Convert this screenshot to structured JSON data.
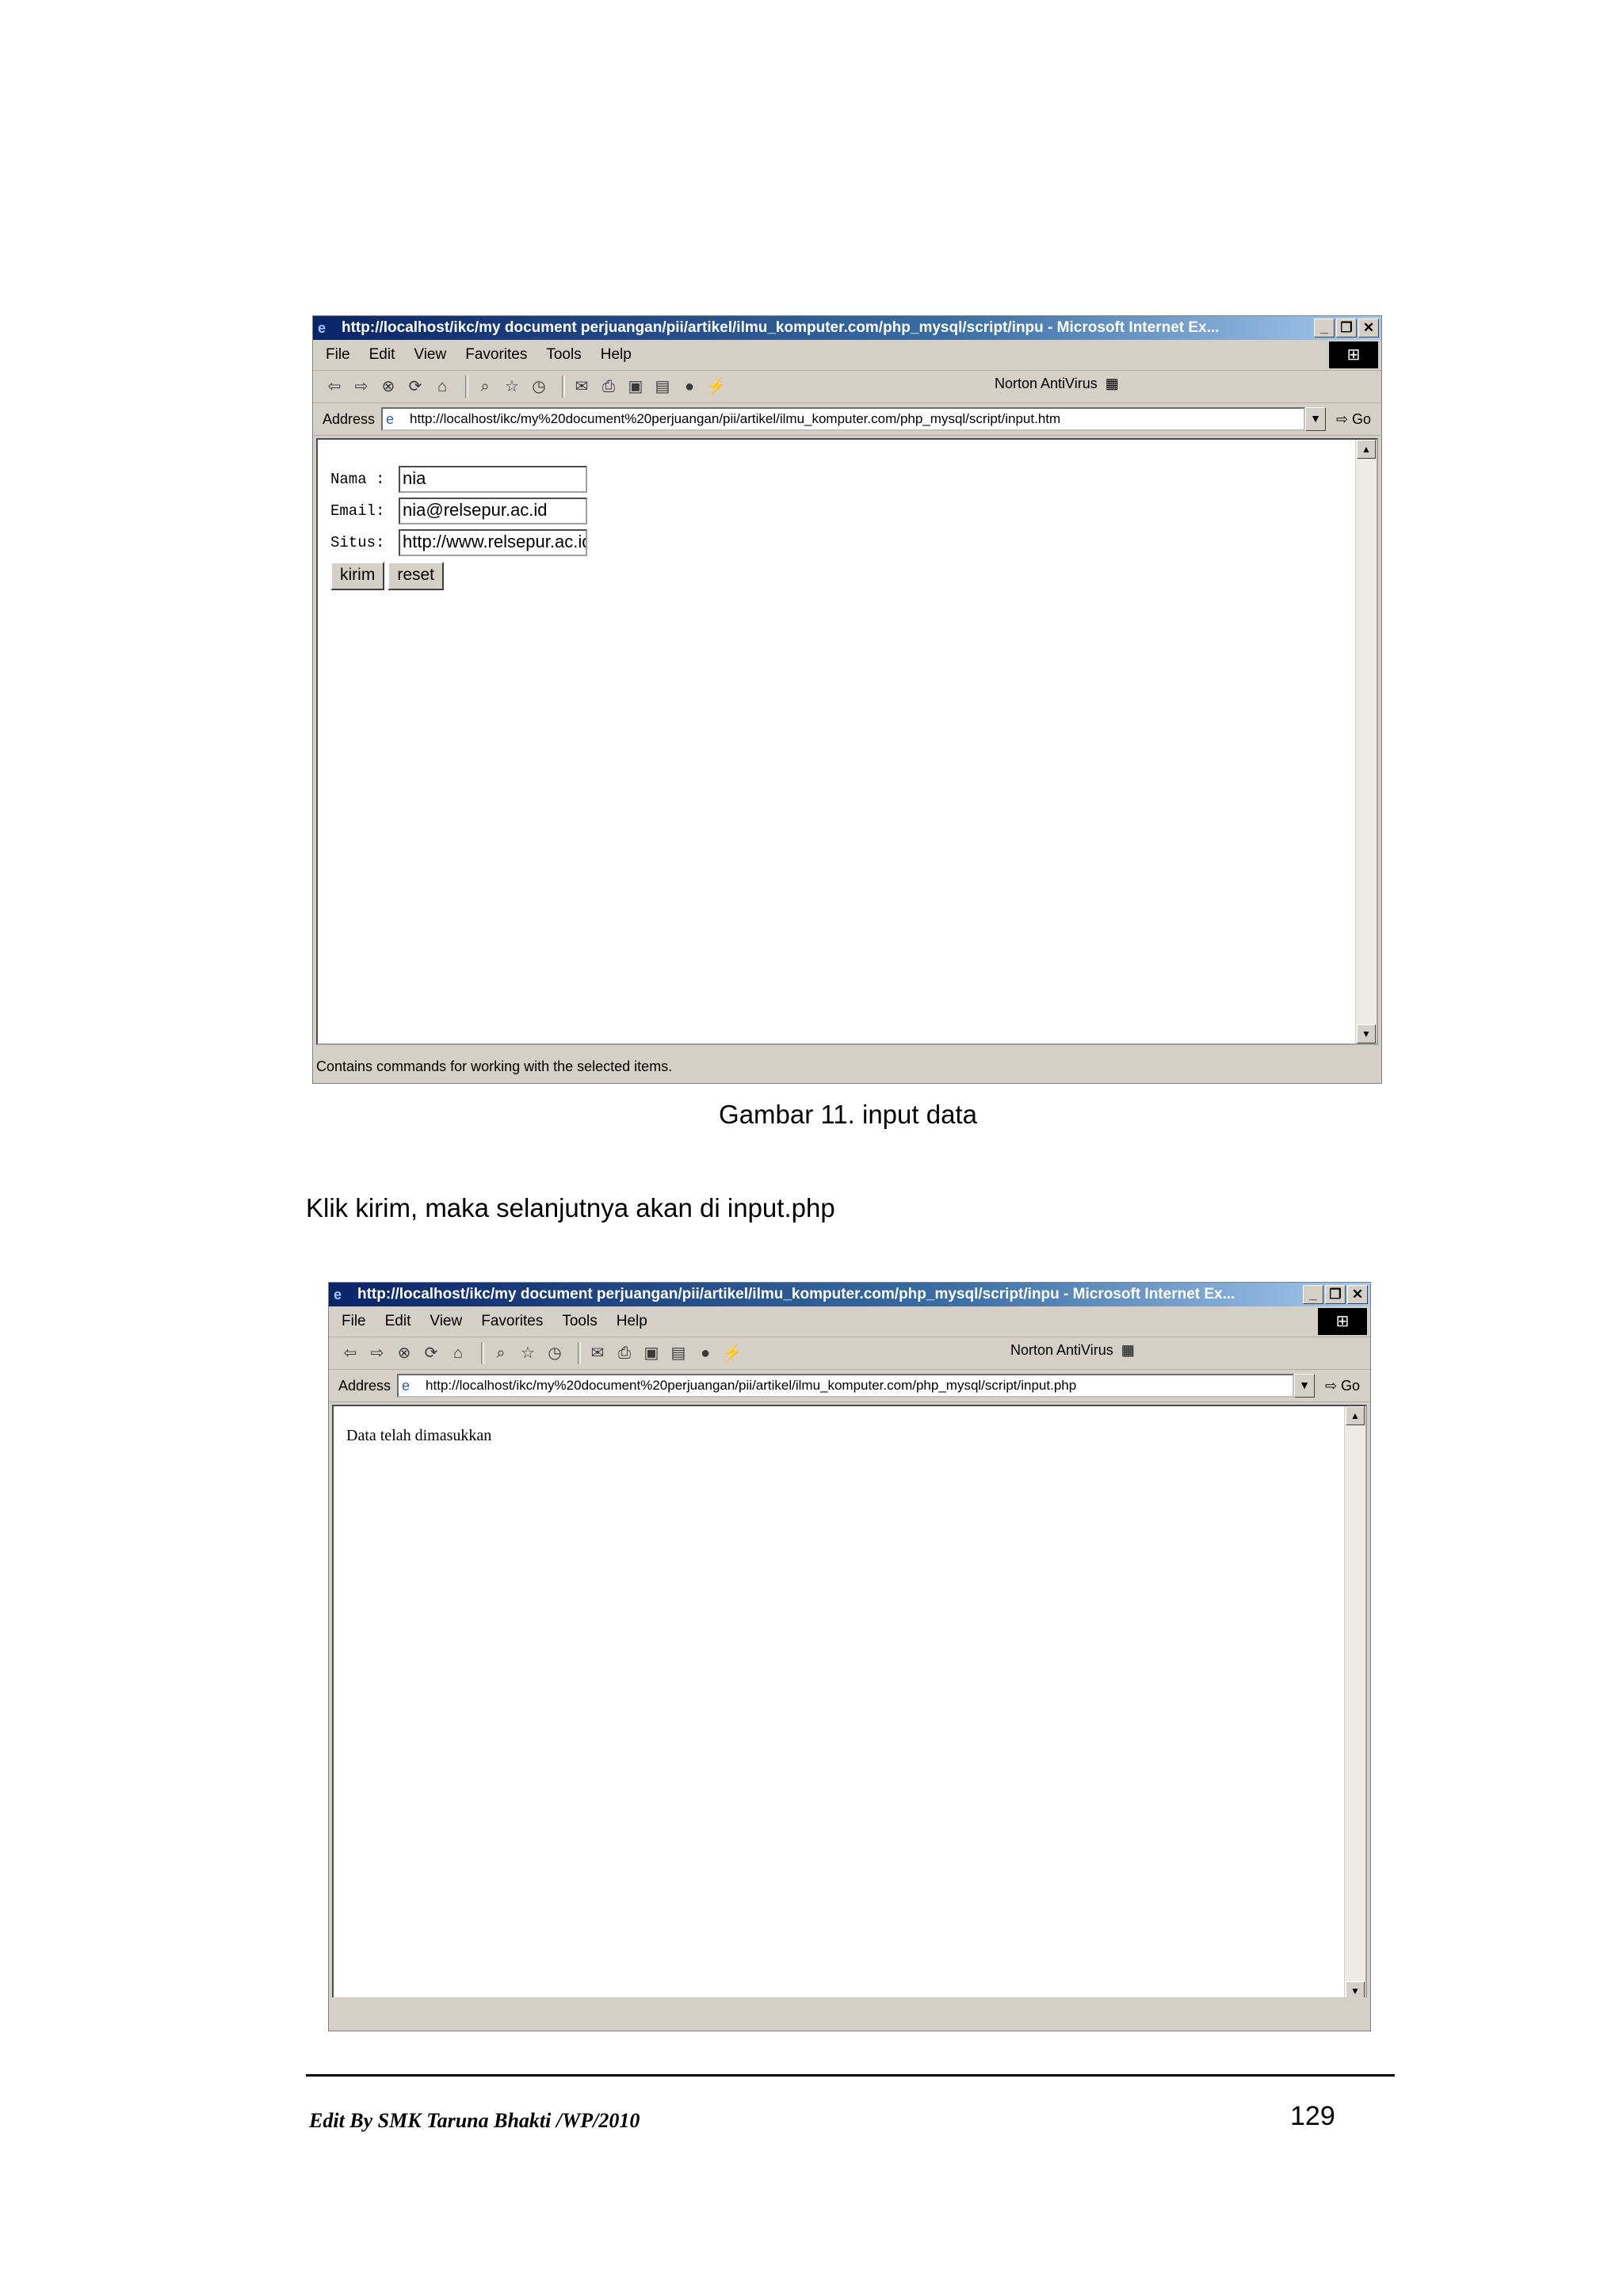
{
  "browser": {
    "title": "http://localhost/ikc/my document perjuangan/pii/artikel/ilmu_komputer.com/php_mysql/script/inpu - Microsoft Internet Ex...",
    "menu": [
      "File",
      "Edit",
      "View",
      "Favorites",
      "Tools",
      "Help"
    ],
    "norton_label": "Norton AntiVirus",
    "address_label": "Address",
    "go_label": "Go"
  },
  "screenshot1": {
    "url": "http://localhost/ikc/my%20document%20perjuangan/pii/artikel/ilmu_komputer.com/php_mysql/script/input.htm",
    "form": {
      "nama_label": "Nama :",
      "nama_value": "nia",
      "email_label": "Email:",
      "email_value": "nia@relsepur.ac.id",
      "situs_label": "Situs:",
      "situs_value": "http://www.relsepur.ac.id",
      "kirim_label": "kirim",
      "reset_label": "reset"
    },
    "status_text": "Contains commands for working with the selected items."
  },
  "caption": "Gambar 11. input data",
  "paragraph": "Klik kirim, maka selanjutnya akan di input.php",
  "screenshot2": {
    "url": "http://localhost/ikc/my%20document%20perjuangan/pii/artikel/ilmu_komputer.com/php_mysql/script/input.php",
    "message": "Data telah dimasukkan"
  },
  "footer": {
    "left": "Edit By SMK Taruna Bhakti /WP/2010",
    "page_number": "129"
  }
}
